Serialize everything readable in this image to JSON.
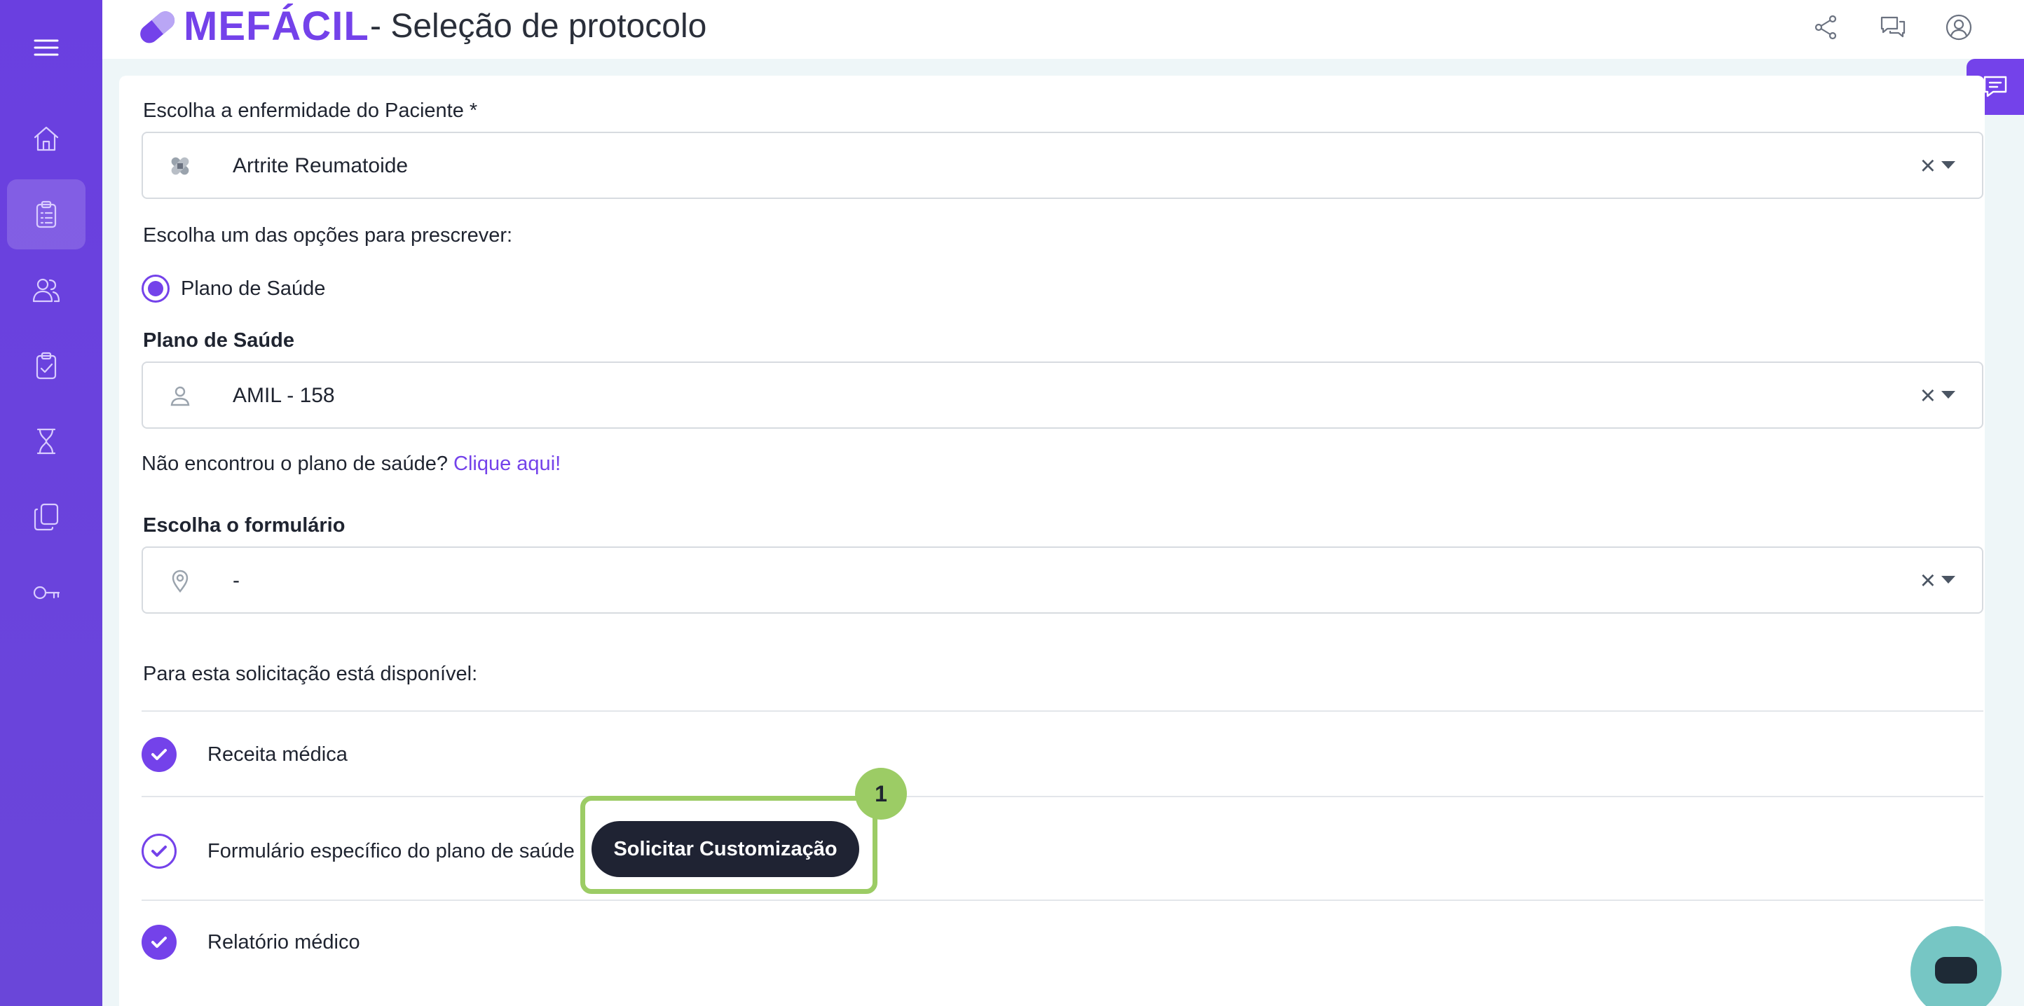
{
  "header": {
    "brand": "MEFÁCIL",
    "title": "- Seleção de protocolo",
    "icons": [
      "share-icon",
      "chat-bubbles-icon",
      "user-circle-icon"
    ]
  },
  "sidebar": {
    "items": [
      {
        "icon": "menu-icon"
      },
      {
        "icon": "home-icon"
      },
      {
        "icon": "clipboard-list-icon",
        "active": true
      },
      {
        "icon": "users-icon"
      },
      {
        "icon": "clipboard-check-icon"
      },
      {
        "icon": "hourglass-icon"
      },
      {
        "icon": "copy-documents-icon"
      },
      {
        "icon": "key-icon"
      }
    ]
  },
  "form": {
    "disease_label": "Escolha a enfermidade do Paciente *",
    "disease_value": "Artrite Reumatoide",
    "options_label": "Escolha um das opções para prescrever:",
    "radio_label": "Plano de Saúde",
    "plan_label": "Plano de Saúde",
    "plan_value": "AMIL - 158",
    "not_found_text": "Não encontrou o plano de saúde?",
    "not_found_link": "Clique aqui!",
    "form_label": "Escolha o formulário",
    "form_value": "-",
    "clear_symbol": "×"
  },
  "availability": {
    "heading": "Para esta solicitação está disponível:",
    "items": [
      {
        "label": "Receita médica",
        "state": "filled"
      },
      {
        "label": "Formulário específico do plano de saúde",
        "state": "outline"
      },
      {
        "label": "Relatório médico",
        "state": "filled"
      }
    ],
    "cta_label": "Solicitar Customização",
    "step_badge": "1"
  },
  "colors": {
    "accent": "#7442ea",
    "sidebar": "#6a3fe0",
    "highlight": "#9ccc65",
    "cta": "#1f2333",
    "chat": "#76c6c4"
  }
}
